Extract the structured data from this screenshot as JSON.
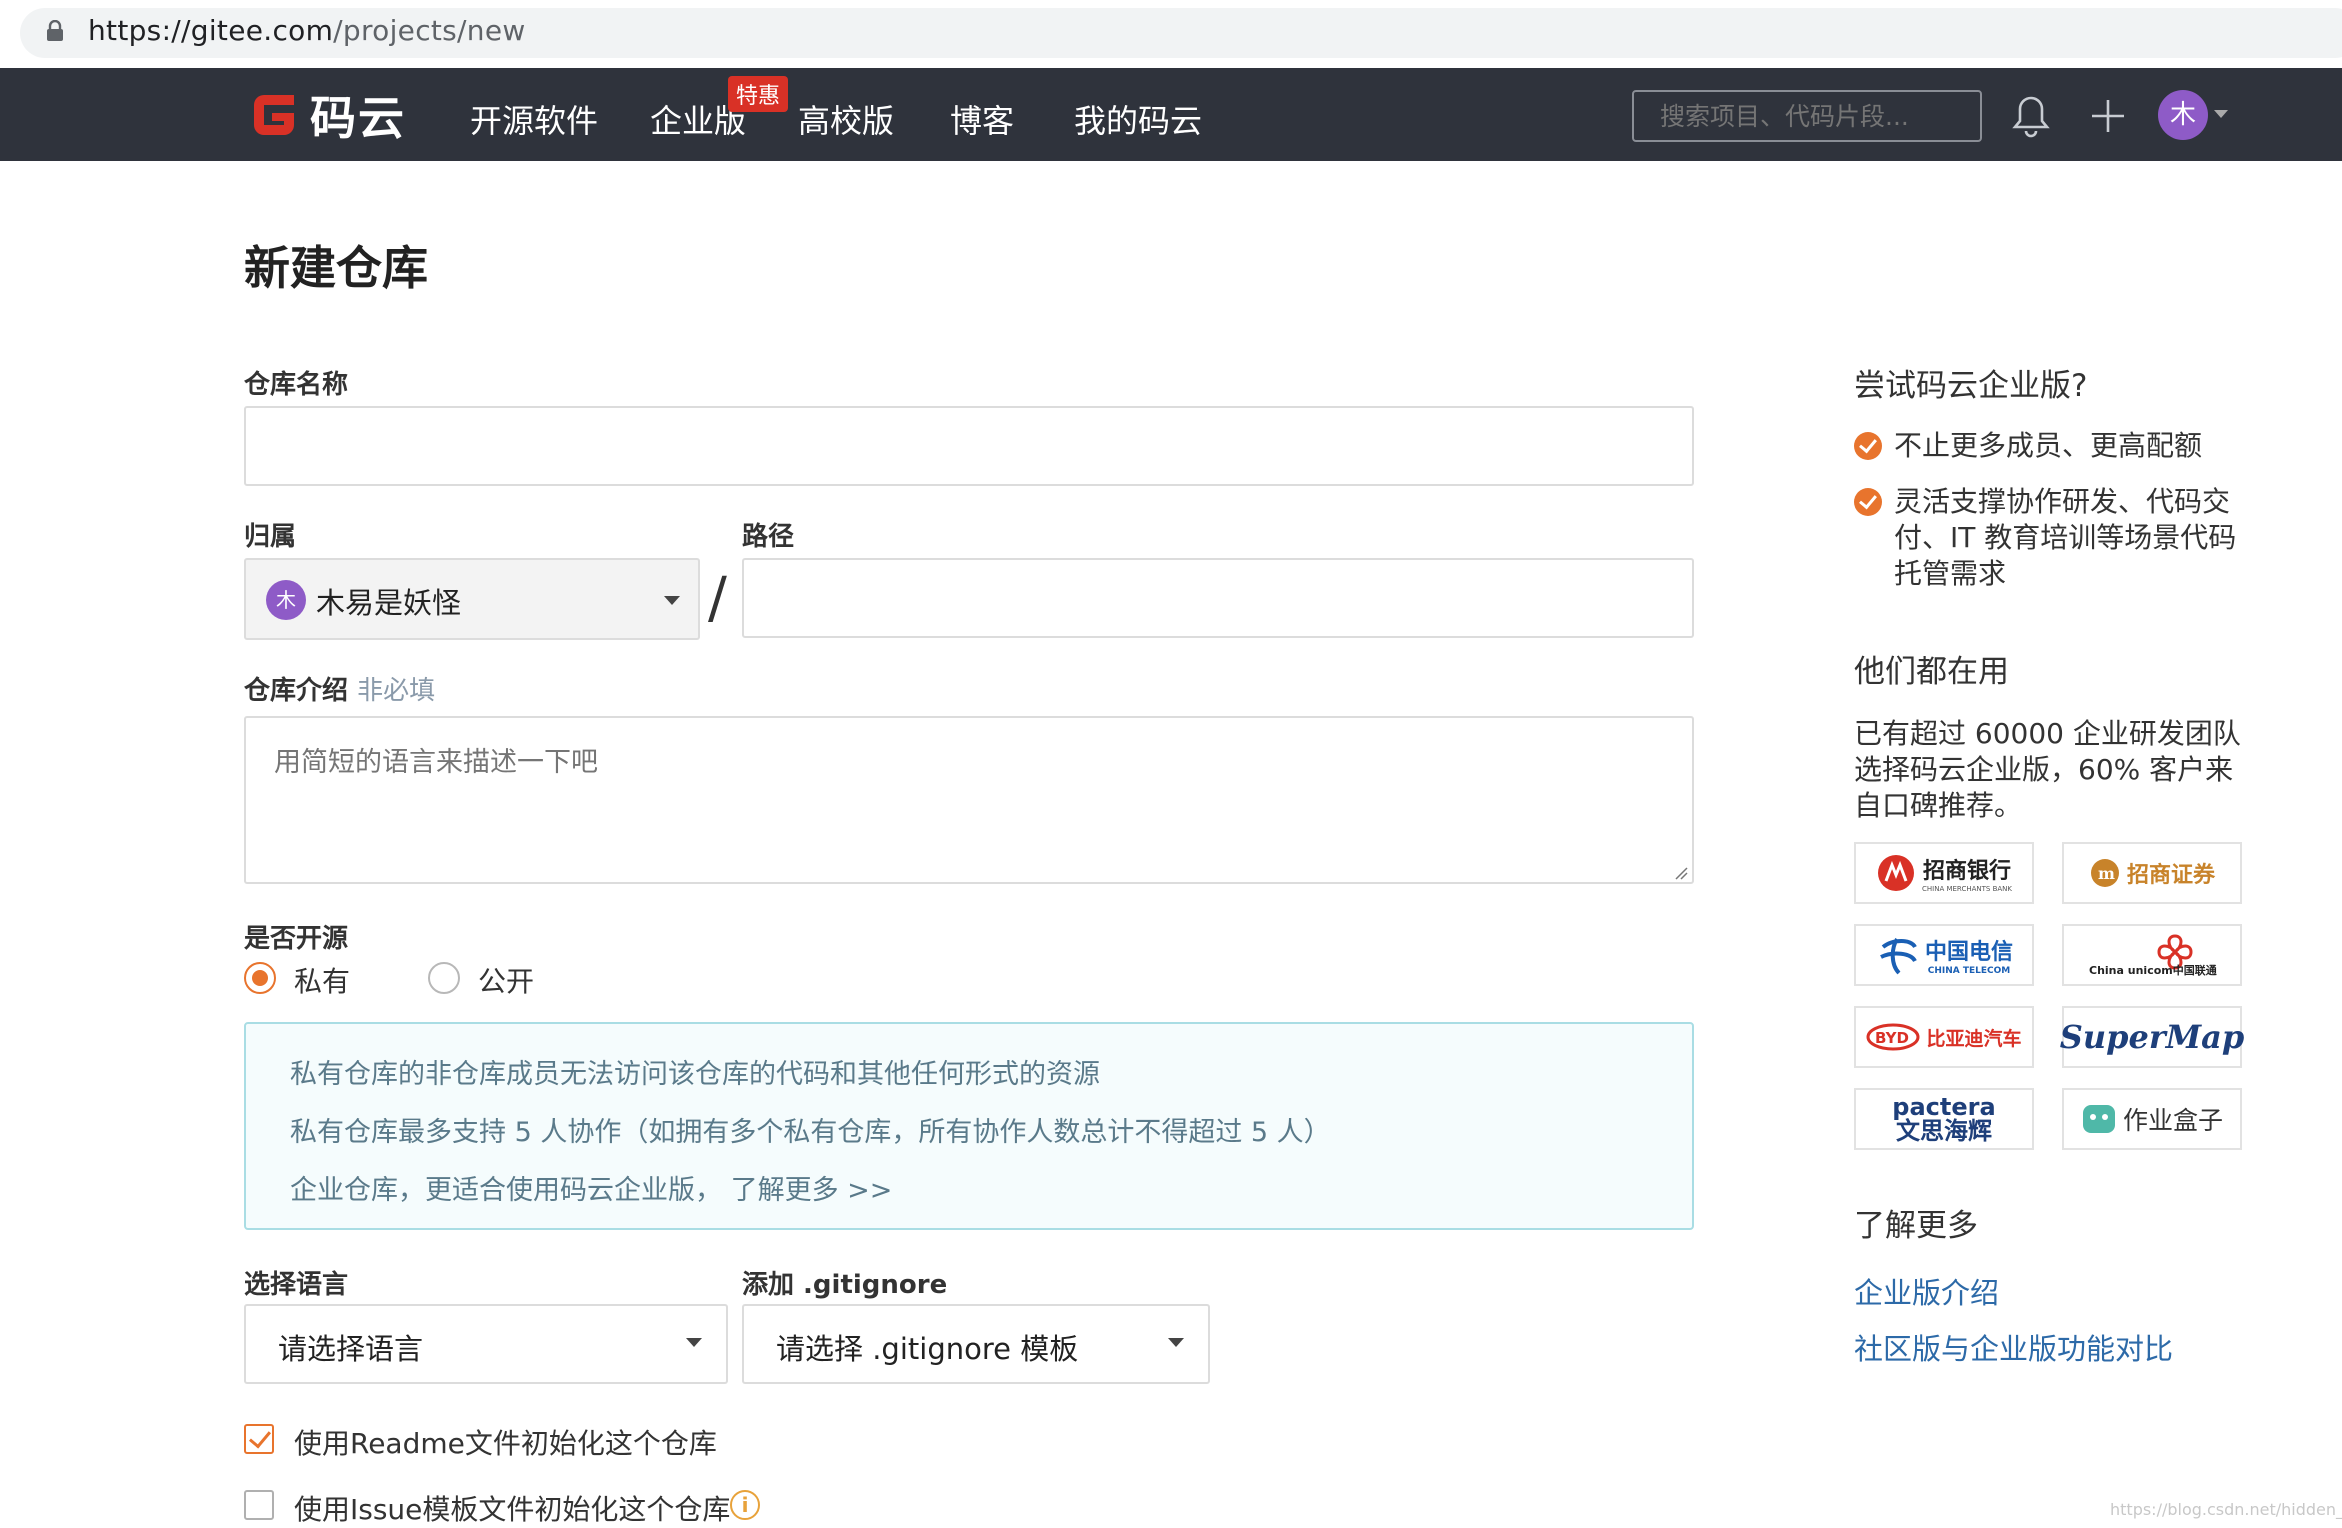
{
  "browser": {
    "url_host": "https://gitee.com",
    "url_path": "/projects/new"
  },
  "nav": {
    "logo_text": "码云",
    "items": [
      "开源软件",
      "企业版",
      "高校版",
      "博客",
      "我的码云"
    ],
    "badge": "特惠",
    "search_placeholder": "搜索项目、代码片段...",
    "avatar_initial": "木"
  },
  "form": {
    "title": "新建仓库",
    "repo_name_label": "仓库名称",
    "owner_label": "归属",
    "path_label": "路径",
    "owner_initial": "木",
    "owner_name": "木易是妖怪",
    "slash": "/",
    "desc_label": "仓库介绍",
    "desc_optional": "非必填",
    "desc_placeholder": "用简短的语言来描述一下吧",
    "visibility_label": "是否开源",
    "visibility_options": [
      "私有",
      "公开"
    ],
    "visibility_selected": "私有",
    "info_lines": [
      "私有仓库的非仓库成员无法访问该仓库的代码和其他任何形式的资源",
      "私有仓库最多支持 5 人协作（如拥有多个私有仓库，所有协作人数总计不得超过 5 人）",
      "企业仓库，更适合使用码云企业版，  了解更多 >>"
    ],
    "language_label": "选择语言",
    "language_value": "请选择语言",
    "gitignore_label": "添加 .gitignore",
    "gitignore_value": "请选择 .gitignore 模板",
    "readme_label": "使用Readme文件初始化这个仓库",
    "readme_checked": true,
    "issue_label": "使用Issue模板文件初始化这个仓库",
    "issue_checked": false,
    "info_icon": "i"
  },
  "sidebar": {
    "try_title": "尝试码云企业版?",
    "benefits": [
      "不止更多成员、更高配额",
      "灵活支撑协作研发、代码交付、IT 教育培训等场景代码托管需求"
    ],
    "users_title": "他们都在用",
    "users_text": "已有超过 60000 企业研发团队选择码云企业版，60% 客户来自口碑推荐。",
    "logos": [
      "招商银行",
      "招商证券",
      "中国电信",
      "China unicom中国联通",
      "比亚迪汽车",
      "SuperMap",
      "pactera 文思海辉",
      "作业盒子"
    ],
    "logo_subs": [
      "CHINA MERCHANTS BANK",
      "",
      "CHINA TELECOM",
      "",
      "",
      "",
      "",
      ""
    ],
    "learn_title": "了解更多",
    "links": [
      "企业版介绍",
      "社区版与企业版功能对比"
    ]
  },
  "watermark": "https://blog.csdn.net/hidden_wg",
  "colors": {
    "nav_bg": "#2f333c",
    "accent": "#e8742d",
    "link": "#2d6aa8",
    "logo_red": "#d93126",
    "avatar_purple": "#8e5bc7"
  }
}
